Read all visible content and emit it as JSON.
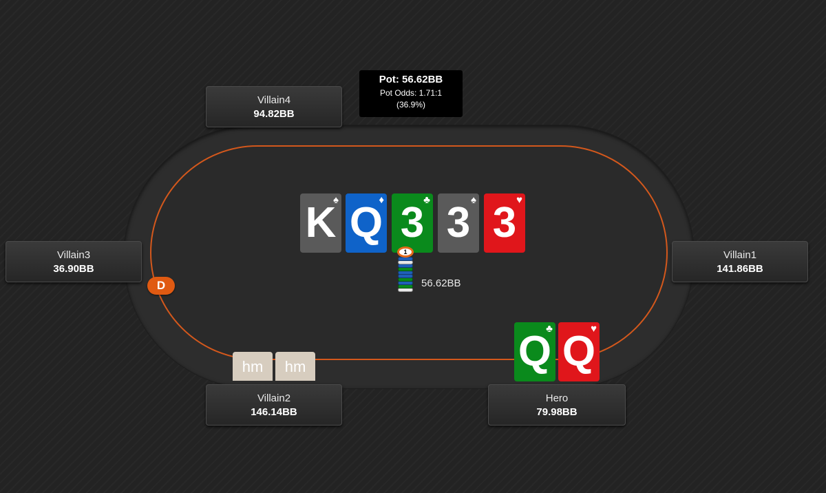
{
  "pot": {
    "label": "Pot: 56.62BB",
    "odds": "Pot Odds: 1.71:1",
    "pct": "(36.9%)"
  },
  "board": [
    {
      "rank": "K",
      "suit": "♠",
      "color": "#5a5a5a"
    },
    {
      "rank": "Q",
      "suit": "♦",
      "color": "#0f63c9"
    },
    {
      "rank": "3",
      "suit": "♣",
      "color": "#0a8a1c"
    },
    {
      "rank": "3",
      "suit": "♠",
      "color": "#5a5a5a"
    },
    {
      "rank": "3",
      "suit": "♥",
      "color": "#e0161b"
    }
  ],
  "players": {
    "villain4": {
      "name": "Villain4",
      "stack": "94.82BB"
    },
    "villain3": {
      "name": "Villain3",
      "stack": "36.90BB"
    },
    "villain1": {
      "name": "Villain1",
      "stack": "141.86BB"
    },
    "villain2": {
      "name": "Villain2",
      "stack": "146.14BB",
      "cards": [
        "hm",
        "hm"
      ]
    },
    "hero": {
      "name": "Hero",
      "stack": "79.98BB",
      "cards": [
        {
          "rank": "Q",
          "suit": "♣",
          "color": "#0a8a1c"
        },
        {
          "rank": "Q",
          "suit": "♥",
          "color": "#e0161b"
        }
      ]
    }
  },
  "dealer_button": "D",
  "chip_top_label": "1",
  "pot_amount": "56.62BB",
  "colors": {
    "felt_rail": "#d4581c",
    "dealer": "#e05a12",
    "background": "#232323"
  }
}
